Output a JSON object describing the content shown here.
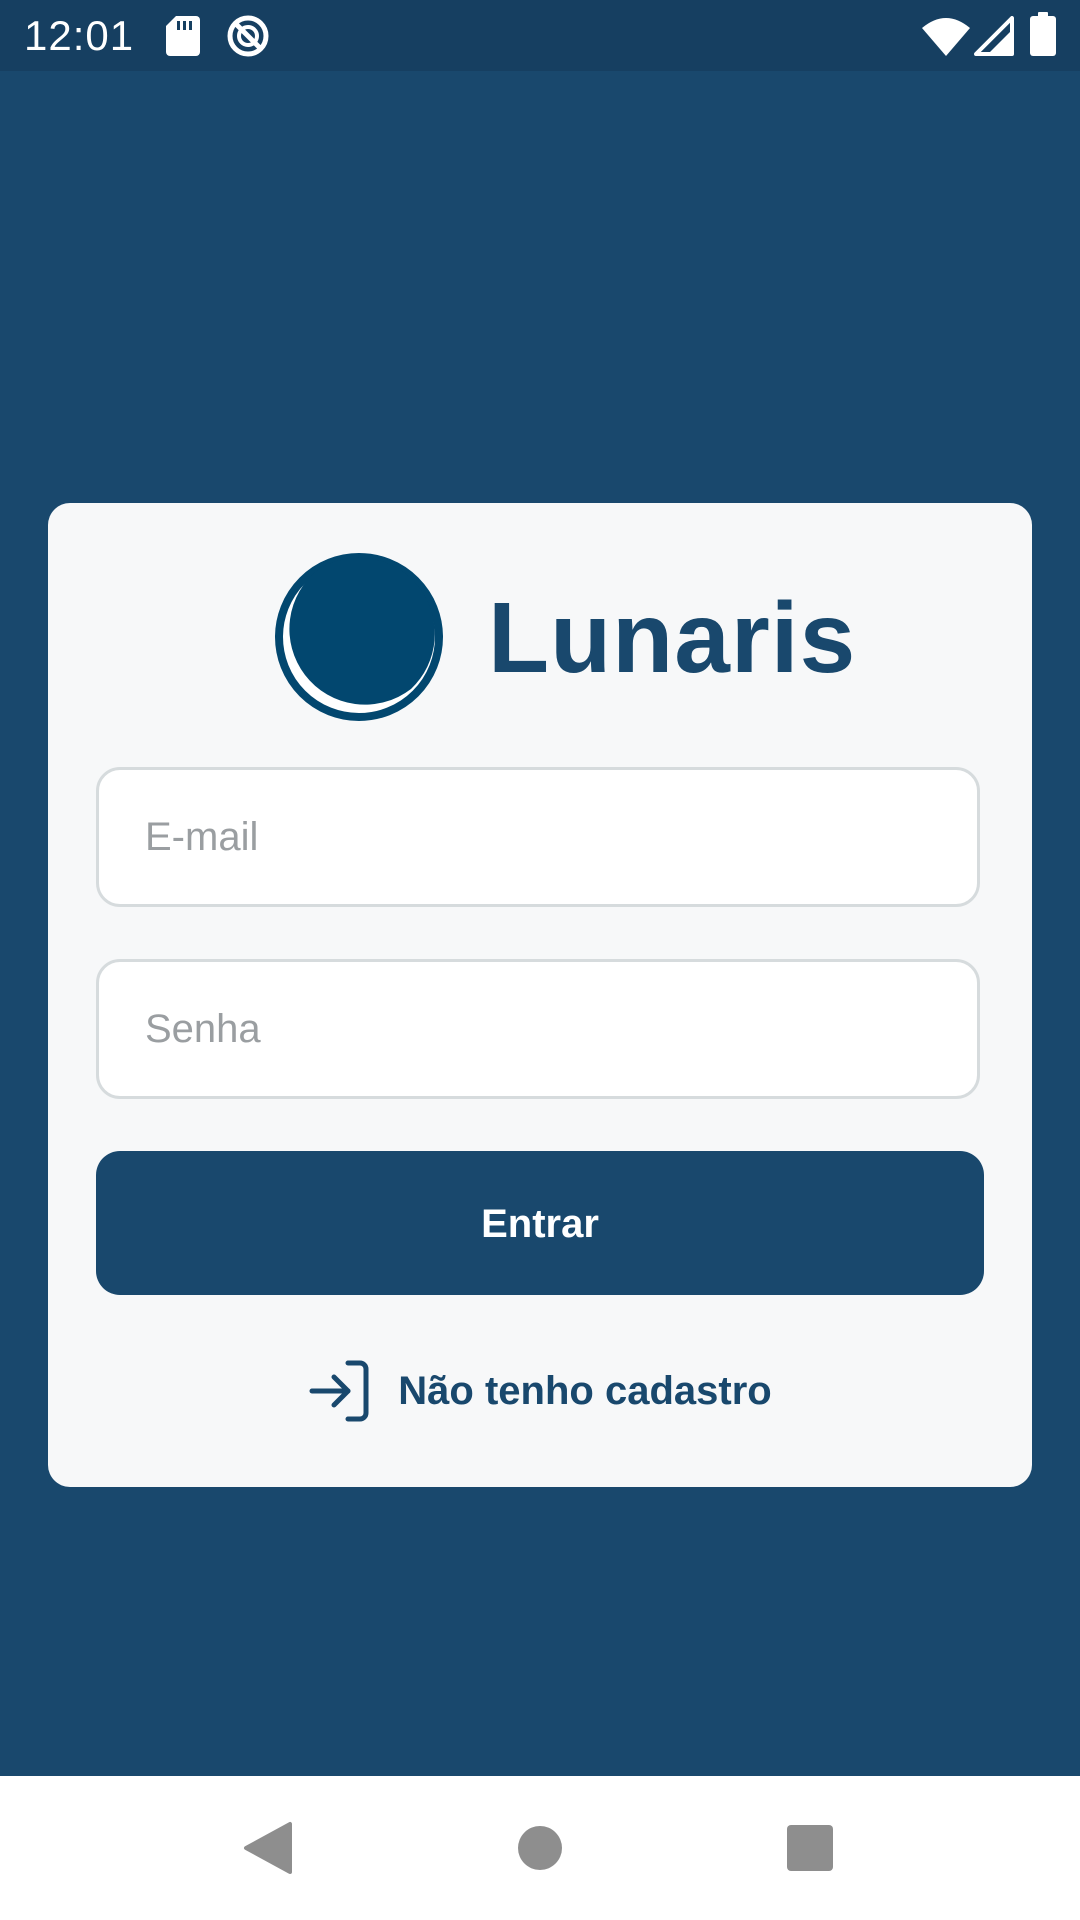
{
  "status_bar": {
    "time": "12:01",
    "icons": [
      "sd-card-icon",
      "do-not-disturb-icon",
      "wifi-icon",
      "signal-icon",
      "battery-icon"
    ]
  },
  "app": {
    "name": "Lunaris",
    "logo_icon": "crescent-moon-logo"
  },
  "login_form": {
    "email_placeholder": "E-mail",
    "password_placeholder": "Senha",
    "submit_label": "Entrar",
    "register_label": "Não tenho cadastro",
    "register_icon": "login-arrow-icon"
  },
  "nav_bar": {
    "buttons": [
      "back-icon",
      "home-icon",
      "recents-icon"
    ]
  },
  "colors": {
    "primary": "#19486d",
    "status_bar": "#163f61",
    "card": "#f7f8f9",
    "field_border": "#d6dbdd",
    "placeholder": "#9a9ea1",
    "logo_fill": "#02476f"
  }
}
